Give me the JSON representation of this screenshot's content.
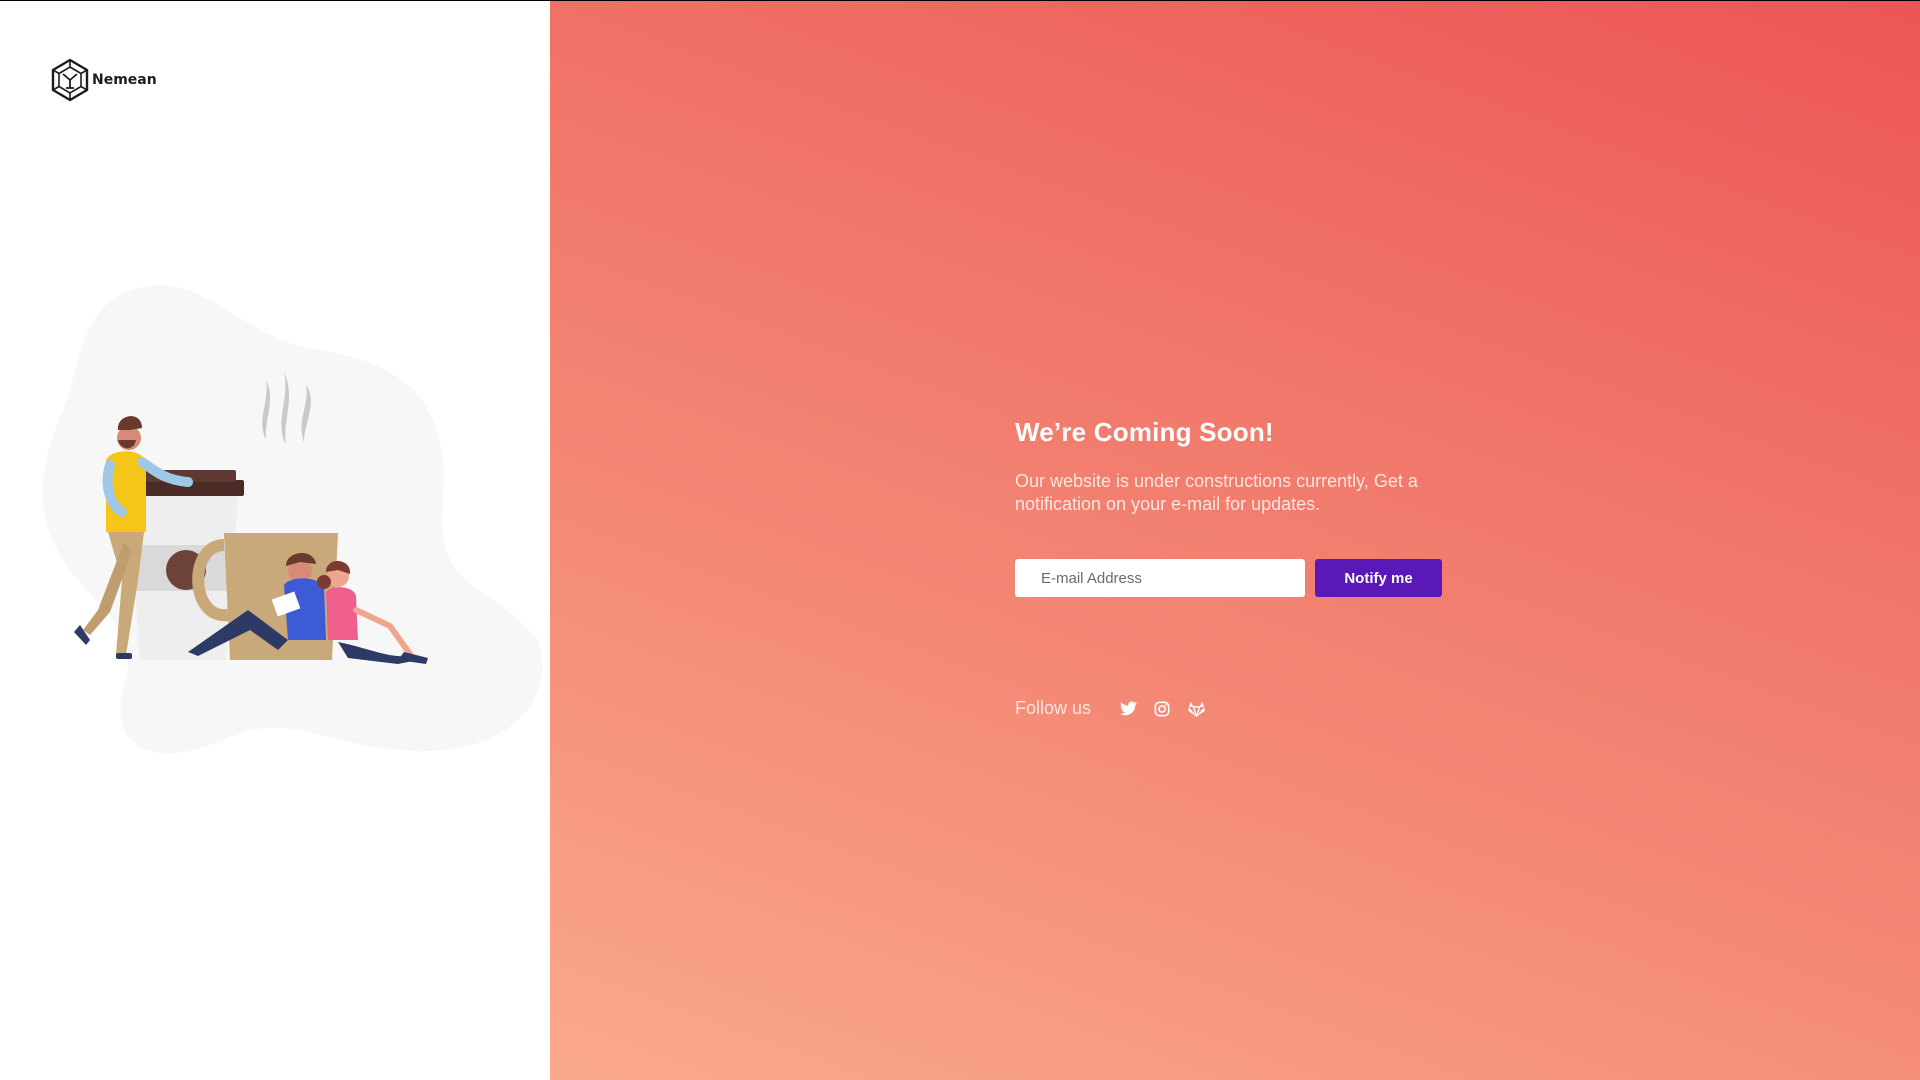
{
  "brand": {
    "name": "Nemean"
  },
  "hero": {
    "title": "We’re Coming Soon!",
    "subtitle": "Our website is under constructions currently, Get a notification on your e-mail for updates."
  },
  "form": {
    "email_placeholder": "E-mail Address",
    "submit_label": "Notify me"
  },
  "social": {
    "label": "Follow us",
    "icons": [
      "twitter-icon",
      "instagram-icon",
      "gitlab-icon"
    ]
  },
  "colors": {
    "button": "#5a18b8",
    "gradient_top": "#ec5556",
    "gradient_bottom": "#faa98c",
    "text": "#ffffff"
  }
}
